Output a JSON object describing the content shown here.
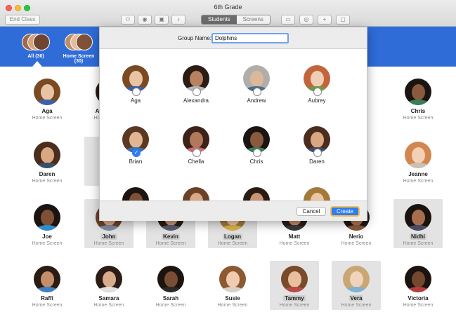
{
  "window": {
    "title": "6th Grade"
  },
  "toolbar": {
    "end_class": "End Class",
    "icons": [
      "group-icon",
      "compass-icon",
      "lock-icon",
      "mute-icon",
      "airplay-icon",
      "screen-share-icon",
      "add-icon",
      "hide-icon"
    ],
    "segments": [
      "Students",
      "Screens"
    ],
    "active_segment": "Students"
  },
  "groups": [
    {
      "label": "All (30)"
    },
    {
      "label": "Home Screen (30)"
    }
  ],
  "students": [
    {
      "name": "Aga",
      "status": "Home Screen",
      "hair": "#7a4a24",
      "skin": "#e8c3a4",
      "shirt": "#3b5fa8"
    },
    {
      "name": "Alexandra",
      "status": "Home Screen",
      "hair": "#2b1c14",
      "skin": "#b98062",
      "shirt": "#b7b7b7"
    },
    {
      "name": "Andrew",
      "status": "Home Screen",
      "hair": "#b0aea9",
      "skin": "#dcb79b",
      "shirt": "#4a6d8c"
    },
    {
      "name": "Aubrey",
      "status": "Home Screen",
      "hair": "#c2653a",
      "skin": "#f0cdb5",
      "shirt": "#6c9a4c"
    },
    {
      "name": "Brian",
      "status": "Home Screen",
      "hair": "#5b3821",
      "skin": "#e1b793",
      "shirt": "#3f6eb0"
    },
    {
      "name": "Chella",
      "status": "Home Screen",
      "hair": "#3c2218",
      "skin": "#b07a5a",
      "shirt": "#c96c7a"
    },
    {
      "name": "Chris",
      "status": "Home Screen",
      "hair": "#1b1410",
      "skin": "#8a5a3e",
      "shirt": "#3a7d5a"
    },
    {
      "name": "Daren",
      "status": "Home Screen",
      "hair": "#4a2d1c",
      "skin": "#d9a882",
      "shirt": "#3a4f6a"
    },
    {
      "name": "Jeanne",
      "status": "Home Screen",
      "hair": "#d28650",
      "skin": "#f3d0b6",
      "shirt": "#c9c1b4"
    },
    {
      "name": "Joe",
      "status": "Home Screen",
      "hair": "#1c1410",
      "skin": "#7e5136",
      "shirt": "#2e8ecb"
    },
    {
      "name": "John",
      "status": "Home Screen",
      "hair": "#6b4227",
      "skin": "#d9a886",
      "shirt": "#7d8ca0"
    },
    {
      "name": "Kevin",
      "status": "Home Screen",
      "hair": "#2a1c14",
      "skin": "#c99574",
      "shirt": "#5a5a72"
    },
    {
      "name": "Logan",
      "status": "Home Screen",
      "hair": "#a37a3a",
      "skin": "#ecc6a4",
      "shirt": "#d9b24a"
    },
    {
      "name": "Matt",
      "status": "Home Screen",
      "hair": "#2b1d16",
      "skin": "#c28c68",
      "shirt": "#3a3a3a"
    },
    {
      "name": "Nerio",
      "status": "Home Screen",
      "hair": "#1f1712",
      "skin": "#b07652",
      "shirt": "#8b5a3c"
    },
    {
      "name": "Nidhi",
      "status": "Home Screen",
      "hair": "#1a120e",
      "skin": "#a66e4c",
      "shirt": "#4a4a66"
    },
    {
      "name": "Raffi",
      "status": "Home Screen",
      "hair": "#2a1c14",
      "skin": "#c48e6a",
      "shirt": "#3f7fc4"
    },
    {
      "name": "Samara",
      "status": "Home Screen",
      "hair": "#2b1d16",
      "skin": "#d8ab8a",
      "shirt": "#e1e1e1"
    },
    {
      "name": "Sarah",
      "status": "Home Screen",
      "hair": "#1c140f",
      "skin": "#7a4e35",
      "shirt": "#2a2a2a"
    },
    {
      "name": "Susie",
      "status": "Home Screen",
      "hair": "#8c5a30",
      "skin": "#f0cbaf",
      "shirt": "#d8d2c8"
    },
    {
      "name": "Tammy",
      "status": "Home Screen",
      "hair": "#7a4a2a",
      "skin": "#e8bfa0",
      "shirt": "#b84a4a"
    },
    {
      "name": "Vera",
      "status": "Home Screen",
      "hair": "#c9a774",
      "skin": "#f1d3bb",
      "shirt": "#7fb2d6"
    },
    {
      "name": "Victoria",
      "status": "Home Screen",
      "hair": "#1b130f",
      "skin": "#74472f",
      "shirt": "#b33e3e"
    }
  ],
  "sheet": {
    "label": "Group Name:",
    "value": "Dolphins",
    "cancel": "Cancel",
    "create": "Create",
    "picks": [
      {
        "name": "Aga",
        "checked": false
      },
      {
        "name": "Alexandra",
        "checked": false
      },
      {
        "name": "Andrew",
        "checked": false
      },
      {
        "name": "Aubrey",
        "checked": false
      },
      {
        "name": "Brian",
        "checked": true
      },
      {
        "name": "Chella",
        "checked": false
      },
      {
        "name": "Chris",
        "checked": false
      },
      {
        "name": "Daren",
        "checked": false
      }
    ]
  },
  "colors": {
    "accent": "#2e7cf6",
    "group_bar": "#2f6cd8",
    "focus": "#f2c04a"
  }
}
